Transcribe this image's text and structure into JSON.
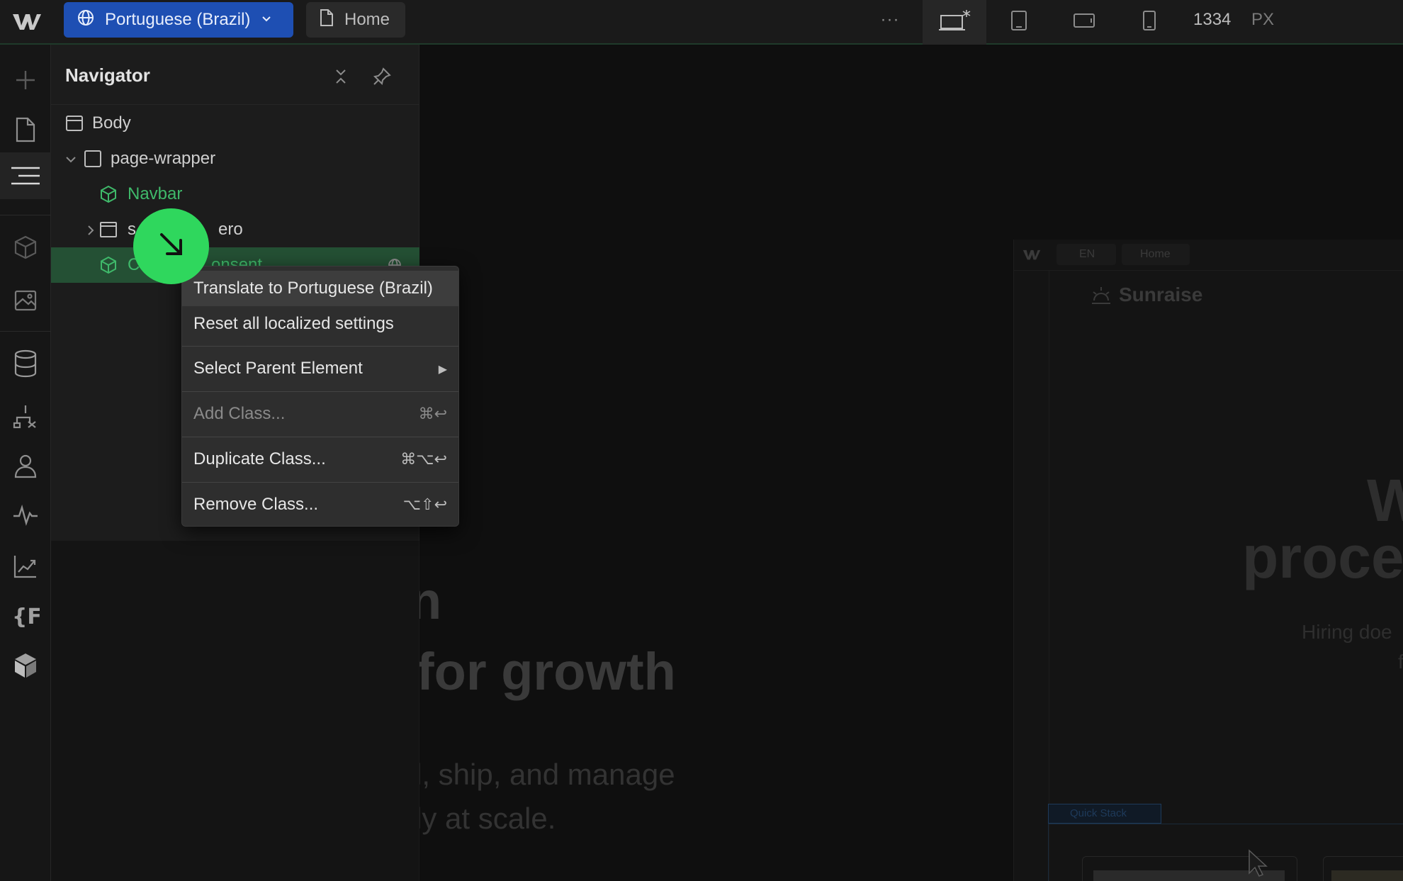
{
  "topbar": {
    "locale_label": "Portuguese (Brazil)",
    "page_label": "Home",
    "more_label": "···",
    "canvas_width": "1334",
    "canvas_unit": "PX"
  },
  "navigator": {
    "title": "Navigator",
    "tree": [
      {
        "label": "Body"
      },
      {
        "label": "page-wrapper"
      },
      {
        "label": "Navbar"
      },
      {
        "label": "s",
        "label_rest": "ero"
      },
      {
        "label": "C",
        "label_rest": "onsent"
      }
    ]
  },
  "context_menu": {
    "items": [
      {
        "label": "Translate to Portuguese (Brazil)",
        "shortcut": ""
      },
      {
        "label": "Reset all localized settings",
        "shortcut": ""
      },
      {
        "label": "Select Parent Element",
        "shortcut": "▶"
      },
      {
        "label": "Add Class...",
        "shortcut": "⌘↩"
      },
      {
        "label": "Duplicate Class...",
        "shortcut": "⌘⌥↩"
      },
      {
        "label": "Remove Class...",
        "shortcut": "⌥⇧↩"
      }
    ]
  },
  "canvas": {
    "heading_fragment_1": "n",
    "heading_fragment_2": "for growth",
    "body_fragment_1": "l, ship, and manage",
    "body_fragment_2": "ly at scale.",
    "preview": {
      "lang": "EN",
      "page": "Home",
      "brand": "Sunraise",
      "heading_1": "W",
      "heading_2": "proce",
      "sub_1": "Hiring doe",
      "sub_2": "f",
      "quick_stack": "Quick Stack"
    }
  },
  "colors": {
    "accent_green": "#2fd75d",
    "locale_blue": "#1e4fb3",
    "component_green": "#3fb96a",
    "selected_row": "#245034"
  }
}
